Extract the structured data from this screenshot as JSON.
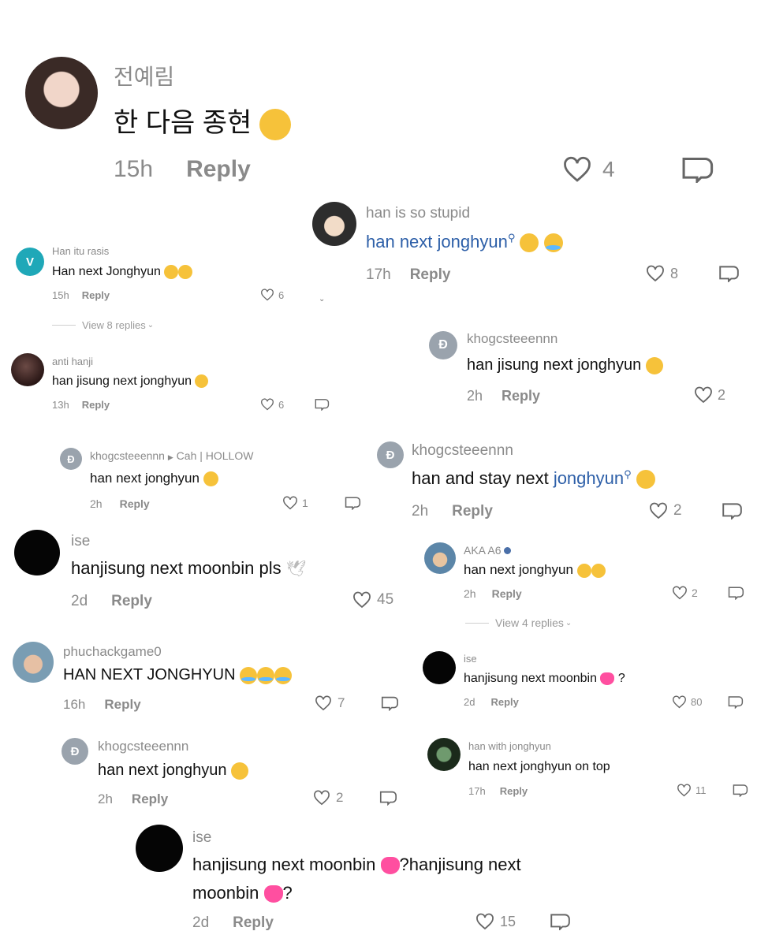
{
  "c1": {
    "user": "전예림",
    "text": "한 다음 종현",
    "time": "15h",
    "reply": "Reply",
    "likes": "4"
  },
  "c2": {
    "user": "han is so stupid",
    "text": "han next jonghyun",
    "time": "17h",
    "reply": "Reply",
    "likes": "8"
  },
  "c3": {
    "avatar_letter": "V",
    "user": "Han itu rasis",
    "text": "Han next Jonghyun",
    "time": "15h",
    "reply": "Reply",
    "likes": "6",
    "view_replies": "View 8 replies"
  },
  "c4": {
    "avatar_letter": "Đ",
    "user": "khogcsteeennn",
    "text": "han jisung next jonghyun",
    "time": "2h",
    "reply": "Reply",
    "likes": "2"
  },
  "c5": {
    "user": "anti hanji",
    "text": "han jisung next jonghyun",
    "time": "13h",
    "reply": "Reply",
    "likes": "6"
  },
  "c6": {
    "avatar_letter": "Đ",
    "user": "khogcsteeennn",
    "reply_to": "Cah | HOLLOW",
    "text": "han next jonghyun",
    "time": "2h",
    "reply": "Reply",
    "likes": "1"
  },
  "c7": {
    "avatar_letter": "Đ",
    "user": "khogcsteeennn",
    "text_a": "han and stay next",
    "text_b": "jonghyun",
    "time": "2h",
    "reply": "Reply",
    "likes": "2"
  },
  "c8": {
    "user": "ise",
    "text": "hanjisung next moonbin pls",
    "time": "2d",
    "reply": "Reply",
    "likes": "45"
  },
  "c9": {
    "user": "AKA A6",
    "text": "han next jonghyun",
    "time": "2h",
    "reply": "Reply",
    "likes": "2",
    "view_replies": "View 4 replies"
  },
  "c10": {
    "user": "phuchackgame0",
    "text": "HAN NEXT JONGHYUN",
    "time": "16h",
    "reply": "Reply",
    "likes": "7"
  },
  "c11": {
    "user": "ise",
    "text": "hanjisung next moonbin",
    "text_end": "?",
    "time": "2d",
    "reply": "Reply",
    "likes": "80"
  },
  "c12": {
    "avatar_letter": "Đ",
    "user": "khogcsteeennn",
    "text": "han next jonghyun",
    "time": "2h",
    "reply": "Reply",
    "likes": "2"
  },
  "c13": {
    "user": "han with jonghyun",
    "text": "han next jonghyun on top",
    "time": "17h",
    "reply": "Reply",
    "likes": "11"
  },
  "c14": {
    "user": "ise",
    "text_line1_a": "hanjisung next moonbin",
    "text_line1_b": "?hanjisung next",
    "text_line2": "moonbin",
    "text_line2_end": "?",
    "time": "2d",
    "reply": "Reply",
    "likes": "15"
  }
}
